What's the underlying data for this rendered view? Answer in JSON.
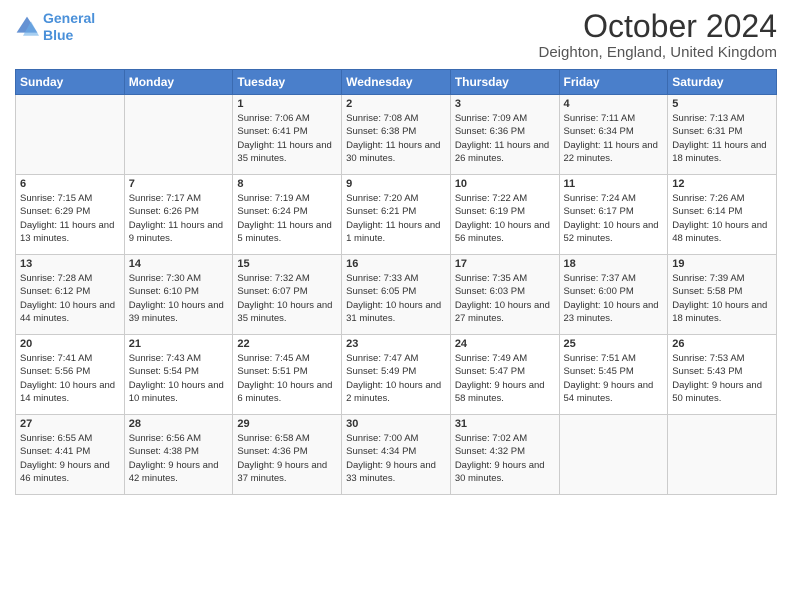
{
  "logo": {
    "line1": "General",
    "line2": "Blue"
  },
  "title": "October 2024",
  "location": "Deighton, England, United Kingdom",
  "headers": [
    "Sunday",
    "Monday",
    "Tuesday",
    "Wednesday",
    "Thursday",
    "Friday",
    "Saturday"
  ],
  "weeks": [
    [
      {
        "day": "",
        "content": ""
      },
      {
        "day": "",
        "content": ""
      },
      {
        "day": "1",
        "content": "Sunrise: 7:06 AM\nSunset: 6:41 PM\nDaylight: 11 hours and 35 minutes."
      },
      {
        "day": "2",
        "content": "Sunrise: 7:08 AM\nSunset: 6:38 PM\nDaylight: 11 hours and 30 minutes."
      },
      {
        "day": "3",
        "content": "Sunrise: 7:09 AM\nSunset: 6:36 PM\nDaylight: 11 hours and 26 minutes."
      },
      {
        "day": "4",
        "content": "Sunrise: 7:11 AM\nSunset: 6:34 PM\nDaylight: 11 hours and 22 minutes."
      },
      {
        "day": "5",
        "content": "Sunrise: 7:13 AM\nSunset: 6:31 PM\nDaylight: 11 hours and 18 minutes."
      }
    ],
    [
      {
        "day": "6",
        "content": "Sunrise: 7:15 AM\nSunset: 6:29 PM\nDaylight: 11 hours and 13 minutes."
      },
      {
        "day": "7",
        "content": "Sunrise: 7:17 AM\nSunset: 6:26 PM\nDaylight: 11 hours and 9 minutes."
      },
      {
        "day": "8",
        "content": "Sunrise: 7:19 AM\nSunset: 6:24 PM\nDaylight: 11 hours and 5 minutes."
      },
      {
        "day": "9",
        "content": "Sunrise: 7:20 AM\nSunset: 6:21 PM\nDaylight: 11 hours and 1 minute."
      },
      {
        "day": "10",
        "content": "Sunrise: 7:22 AM\nSunset: 6:19 PM\nDaylight: 10 hours and 56 minutes."
      },
      {
        "day": "11",
        "content": "Sunrise: 7:24 AM\nSunset: 6:17 PM\nDaylight: 10 hours and 52 minutes."
      },
      {
        "day": "12",
        "content": "Sunrise: 7:26 AM\nSunset: 6:14 PM\nDaylight: 10 hours and 48 minutes."
      }
    ],
    [
      {
        "day": "13",
        "content": "Sunrise: 7:28 AM\nSunset: 6:12 PM\nDaylight: 10 hours and 44 minutes."
      },
      {
        "day": "14",
        "content": "Sunrise: 7:30 AM\nSunset: 6:10 PM\nDaylight: 10 hours and 39 minutes."
      },
      {
        "day": "15",
        "content": "Sunrise: 7:32 AM\nSunset: 6:07 PM\nDaylight: 10 hours and 35 minutes."
      },
      {
        "day": "16",
        "content": "Sunrise: 7:33 AM\nSunset: 6:05 PM\nDaylight: 10 hours and 31 minutes."
      },
      {
        "day": "17",
        "content": "Sunrise: 7:35 AM\nSunset: 6:03 PM\nDaylight: 10 hours and 27 minutes."
      },
      {
        "day": "18",
        "content": "Sunrise: 7:37 AM\nSunset: 6:00 PM\nDaylight: 10 hours and 23 minutes."
      },
      {
        "day": "19",
        "content": "Sunrise: 7:39 AM\nSunset: 5:58 PM\nDaylight: 10 hours and 18 minutes."
      }
    ],
    [
      {
        "day": "20",
        "content": "Sunrise: 7:41 AM\nSunset: 5:56 PM\nDaylight: 10 hours and 14 minutes."
      },
      {
        "day": "21",
        "content": "Sunrise: 7:43 AM\nSunset: 5:54 PM\nDaylight: 10 hours and 10 minutes."
      },
      {
        "day": "22",
        "content": "Sunrise: 7:45 AM\nSunset: 5:51 PM\nDaylight: 10 hours and 6 minutes."
      },
      {
        "day": "23",
        "content": "Sunrise: 7:47 AM\nSunset: 5:49 PM\nDaylight: 10 hours and 2 minutes."
      },
      {
        "day": "24",
        "content": "Sunrise: 7:49 AM\nSunset: 5:47 PM\nDaylight: 9 hours and 58 minutes."
      },
      {
        "day": "25",
        "content": "Sunrise: 7:51 AM\nSunset: 5:45 PM\nDaylight: 9 hours and 54 minutes."
      },
      {
        "day": "26",
        "content": "Sunrise: 7:53 AM\nSunset: 5:43 PM\nDaylight: 9 hours and 50 minutes."
      }
    ],
    [
      {
        "day": "27",
        "content": "Sunrise: 6:55 AM\nSunset: 4:41 PM\nDaylight: 9 hours and 46 minutes."
      },
      {
        "day": "28",
        "content": "Sunrise: 6:56 AM\nSunset: 4:38 PM\nDaylight: 9 hours and 42 minutes."
      },
      {
        "day": "29",
        "content": "Sunrise: 6:58 AM\nSunset: 4:36 PM\nDaylight: 9 hours and 37 minutes."
      },
      {
        "day": "30",
        "content": "Sunrise: 7:00 AM\nSunset: 4:34 PM\nDaylight: 9 hours and 33 minutes."
      },
      {
        "day": "31",
        "content": "Sunrise: 7:02 AM\nSunset: 4:32 PM\nDaylight: 9 hours and 30 minutes."
      },
      {
        "day": "",
        "content": ""
      },
      {
        "day": "",
        "content": ""
      }
    ]
  ]
}
